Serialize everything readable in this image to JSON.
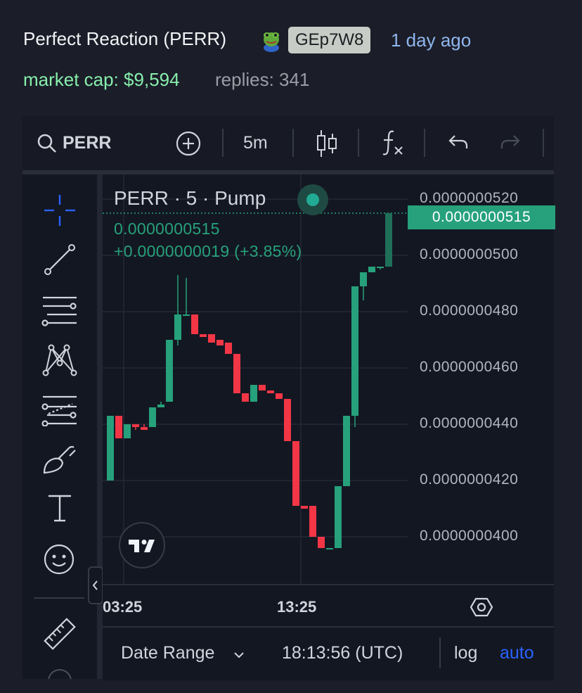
{
  "header": {
    "title": "Perfect Reaction (PERR)",
    "ticker_badge": "GEp7W8",
    "age": "1 day ago",
    "market_cap": "market cap: $9,594",
    "replies": "replies: 341",
    "pepe_icon": "frog-emoji-icon"
  },
  "toolbar": {
    "symbol": "PERR",
    "interval": "5m",
    "icons": [
      "search-icon",
      "add-icon",
      "candles-icon",
      "indicators-icon",
      "undo-icon",
      "redo-icon"
    ]
  },
  "left_tools": [
    "crosshair-icon",
    "trend-line-icon",
    "horizontal-lines-icon",
    "pattern-icon",
    "fib-icon",
    "brush-icon",
    "text-icon",
    "emoji-icon",
    "ruler-icon"
  ],
  "legend": {
    "symbol_line": "PERR · 5 · Pump",
    "value": "0.0000000515",
    "change": "+0.0000000019 (+3.85%)"
  },
  "price_axis": {
    "labels": [
      "0.0000000520",
      "0.0000000500",
      "0.0000000480",
      "0.0000000460",
      "0.0000000440",
      "0.0000000420",
      "0.0000000400"
    ],
    "last_price": "0.0000000515"
  },
  "time_axis": {
    "labels": [
      "03:25",
      "13:25"
    ]
  },
  "bottom_bar": {
    "date_range": "Date Range",
    "clock": "18:13:56 (UTC)",
    "log": "log",
    "auto": "auto"
  },
  "colors": {
    "up": "#26a17b",
    "down": "#f23645",
    "auto": "#2962ff",
    "mcap": "#86efac"
  },
  "chart_data": {
    "type": "candlestick",
    "interval": "5m",
    "ylim": [
      3.95e-08,
      5.25e-08
    ],
    "candles": [
      {
        "o": 4.2e-08,
        "h": 4.43e-08,
        "l": 4.2e-08,
        "c": 4.43e-08
      },
      {
        "o": 4.43e-08,
        "h": 4.43e-08,
        "l": 4.35e-08,
        "c": 4.35e-08
      },
      {
        "o": 4.35e-08,
        "h": 4.4e-08,
        "l": 4.35e-08,
        "c": 4.4e-08
      },
      {
        "o": 4.4e-08,
        "h": 4.4e-08,
        "l": 4.38e-08,
        "c": 4.39e-08
      },
      {
        "o": 4.39e-08,
        "h": 4.4e-08,
        "l": 4.38e-08,
        "c": 4.38e-08
      },
      {
        "o": 4.39e-08,
        "h": 4.46e-08,
        "l": 4.39e-08,
        "c": 4.46e-08
      },
      {
        "o": 4.46e-08,
        "h": 4.48e-08,
        "l": 4.46e-08,
        "c": 4.47e-08
      },
      {
        "o": 4.48e-08,
        "h": 4.7e-08,
        "l": 4.48e-08,
        "c": 4.7e-08
      },
      {
        "o": 4.7e-08,
        "h": 4.93e-08,
        "l": 4.68e-08,
        "c": 4.79e-08
      },
      {
        "o": 4.79e-08,
        "h": 4.92e-08,
        "l": 4.79e-08,
        "c": 4.79e-08
      },
      {
        "o": 4.79e-08,
        "h": 4.79e-08,
        "l": 4.72e-08,
        "c": 4.72e-08
      },
      {
        "o": 4.72e-08,
        "h": 4.72e-08,
        "l": 4.71e-08,
        "c": 4.71e-08
      },
      {
        "o": 4.72e-08,
        "h": 4.72e-08,
        "l": 4.69e-08,
        "c": 4.69e-08
      },
      {
        "o": 4.7e-08,
        "h": 4.7e-08,
        "l": 4.68e-08,
        "c": 4.68e-08
      },
      {
        "o": 4.69e-08,
        "h": 4.69e-08,
        "l": 4.65e-08,
        "c": 4.65e-08
      },
      {
        "o": 4.65e-08,
        "h": 4.65e-08,
        "l": 4.51e-08,
        "c": 4.51e-08
      },
      {
        "o": 4.51e-08,
        "h": 4.51e-08,
        "l": 4.48e-08,
        "c": 4.48e-08
      },
      {
        "o": 4.48e-08,
        "h": 4.54e-08,
        "l": 4.48e-08,
        "c": 4.54e-08
      },
      {
        "o": 4.54e-08,
        "h": 4.54e-08,
        "l": 4.52e-08,
        "c": 4.52e-08
      },
      {
        "o": 4.52e-08,
        "h": 4.52e-08,
        "l": 4.51e-08,
        "c": 4.51e-08
      },
      {
        "o": 4.51e-08,
        "h": 4.51e-08,
        "l": 4.49e-08,
        "c": 4.49e-08
      },
      {
        "o": 4.49e-08,
        "h": 4.49e-08,
        "l": 4.34e-08,
        "c": 4.34e-08
      },
      {
        "o": 4.34e-08,
        "h": 4.34e-08,
        "l": 4.11e-08,
        "c": 4.11e-08
      },
      {
        "o": 4.11e-08,
        "h": 4.11e-08,
        "l": 4.1e-08,
        "c": 4.1e-08
      },
      {
        "o": 4.11e-08,
        "h": 4.11e-08,
        "l": 4e-08,
        "c": 4e-08
      },
      {
        "o": 4e-08,
        "h": 4e-08,
        "l": 3.96e-08,
        "c": 3.96e-08
      },
      {
        "o": 3.96e-08,
        "h": 3.96e-08,
        "l": 3.96e-08,
        "c": 3.96e-08
      },
      {
        "o": 3.96e-08,
        "h": 4.18e-08,
        "l": 3.96e-08,
        "c": 4.18e-08
      },
      {
        "o": 4.18e-08,
        "h": 4.43e-08,
        "l": 4.18e-08,
        "c": 4.43e-08
      },
      {
        "o": 4.43e-08,
        "h": 4.89e-08,
        "l": 4.39e-08,
        "c": 4.89e-08
      },
      {
        "o": 4.89e-08,
        "h": 4.94e-08,
        "l": 4.84e-08,
        "c": 4.94e-08
      },
      {
        "o": 4.94e-08,
        "h": 4.96e-08,
        "l": 4.94e-08,
        "c": 4.96e-08
      },
      {
        "o": 4.96e-08,
        "h": 4.96e-08,
        "l": 4.95e-08,
        "c": 4.96e-08
      },
      {
        "o": 4.96e-08,
        "h": 5.15e-08,
        "l": 4.96e-08,
        "c": 5.15e-08
      }
    ]
  }
}
